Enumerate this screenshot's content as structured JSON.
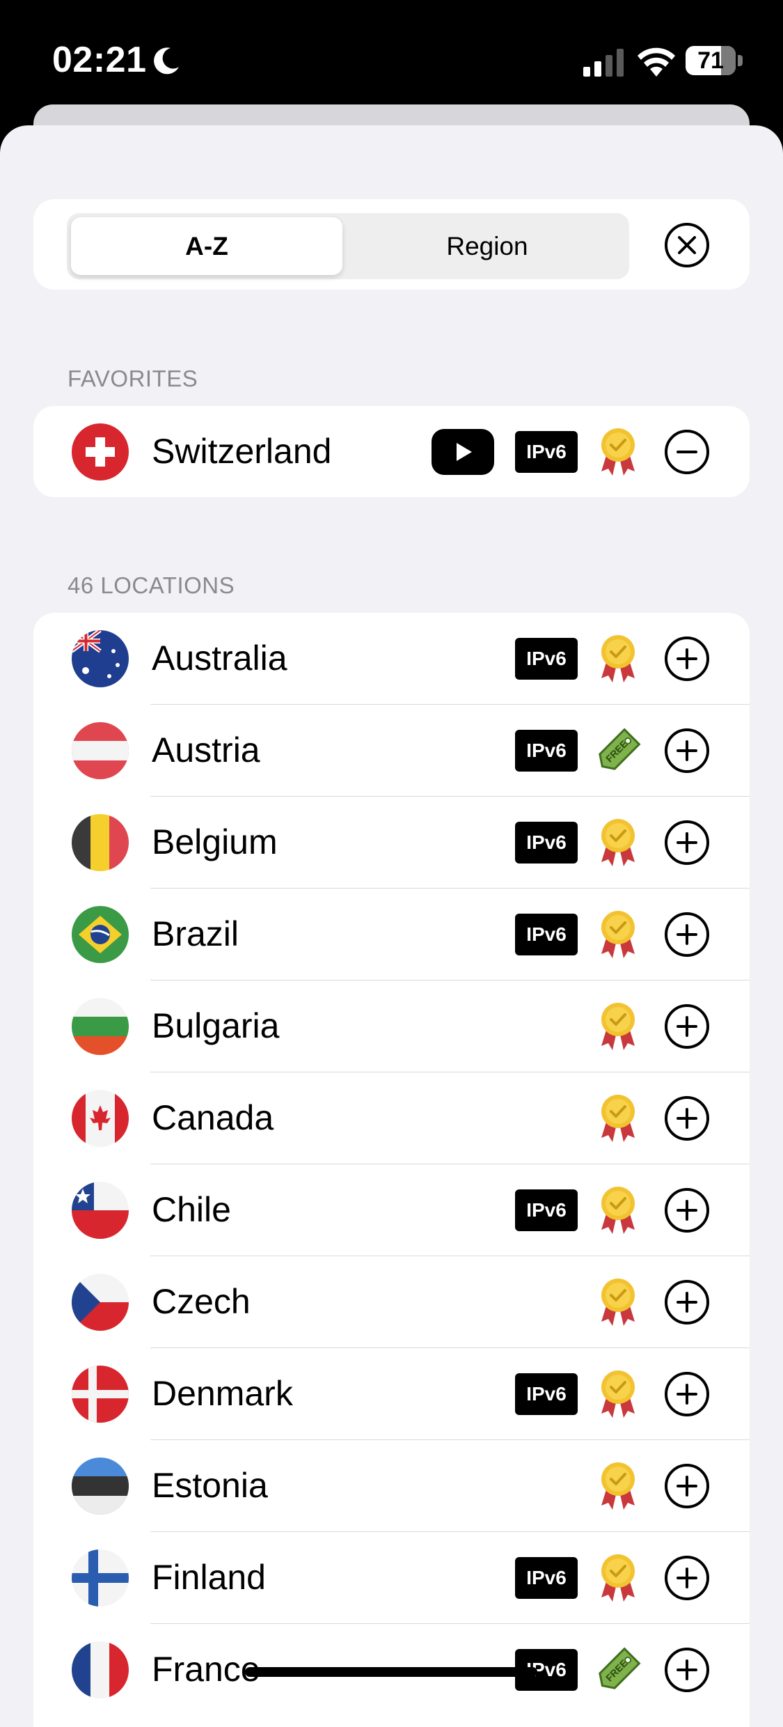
{
  "status_bar": {
    "time": "02:21",
    "battery": "71",
    "battery_level": 0.71
  },
  "segmented": {
    "options": [
      "A-Z",
      "Region"
    ],
    "selected": "A-Z"
  },
  "favorites": {
    "header": "FAVORITES",
    "items": [
      {
        "name": "Switzerland",
        "flag": "ch",
        "streaming": true,
        "ipv6": true,
        "tier": "premium",
        "action": "remove"
      }
    ]
  },
  "locations": {
    "header": "46 LOCATIONS",
    "ipv6_label": "IPv6",
    "items": [
      {
        "name": "Australia",
        "flag": "au",
        "ipv6": true,
        "tier": "premium",
        "action": "add"
      },
      {
        "name": "Austria",
        "flag": "at",
        "ipv6": true,
        "tier": "free",
        "action": "add"
      },
      {
        "name": "Belgium",
        "flag": "be",
        "ipv6": true,
        "tier": "premium",
        "action": "add"
      },
      {
        "name": "Brazil",
        "flag": "br",
        "ipv6": true,
        "tier": "premium",
        "action": "add"
      },
      {
        "name": "Bulgaria",
        "flag": "bg",
        "ipv6": false,
        "tier": "premium",
        "action": "add"
      },
      {
        "name": "Canada",
        "flag": "ca",
        "ipv6": false,
        "tier": "premium",
        "action": "add"
      },
      {
        "name": "Chile",
        "flag": "cl",
        "ipv6": true,
        "tier": "premium",
        "action": "add"
      },
      {
        "name": "Czech",
        "flag": "cz",
        "ipv6": false,
        "tier": "premium",
        "action": "add"
      },
      {
        "name": "Denmark",
        "flag": "dk",
        "ipv6": true,
        "tier": "premium",
        "action": "add"
      },
      {
        "name": "Estonia",
        "flag": "ee",
        "ipv6": false,
        "tier": "premium",
        "action": "add"
      },
      {
        "name": "Finland",
        "flag": "fi",
        "ipv6": true,
        "tier": "premium",
        "action": "add"
      },
      {
        "name": "France",
        "flag": "fr",
        "ipv6": true,
        "tier": "free",
        "action": "add"
      }
    ]
  },
  "free_badge_text": "FREE",
  "colors": {
    "sheet_bg": "#f1f1f6",
    "card_bg": "#ffffff",
    "header_text": "#8a8a8e",
    "premium_gold": "#f2c230",
    "premium_ribbon": "#c8383c",
    "free_green": "#7fb24a"
  }
}
